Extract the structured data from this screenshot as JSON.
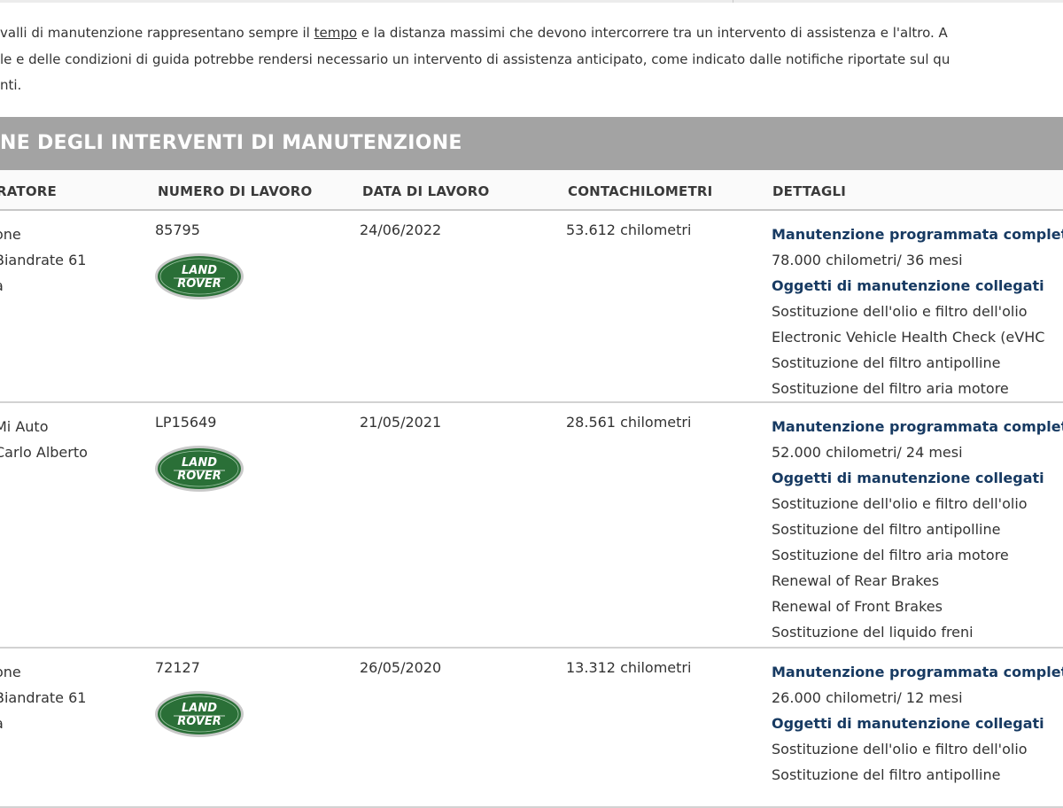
{
  "intro": {
    "line1_a": "valli di manutenzione rappresentano sempre il ",
    "line1_link": "tempo",
    "line1_b": " e la distanza massimi che devono intercorrere tra un intervento di assistenza e l'altro. A",
    "line2": "le e delle condizioni di guida potrebbe rendersi necessario un intervento di assistenza anticipato, come indicato dalle notifiche riportate sul qu",
    "line3": "nti."
  },
  "section": {
    "title": "NE DEGLI INTERVENTI DI MANUTENZIONE"
  },
  "columns": {
    "operator": "RATORE",
    "job_number": "NUMERO DI LAVORO",
    "job_date": "DATA DI LAVORO",
    "odometer": "CONTACHILOMETRI",
    "details": "DETTAGLI"
  },
  "logo": {
    "line1": "LAND",
    "line2": "ROVER",
    "color": "#2a6f37"
  },
  "records": [
    {
      "operator": [
        "one",
        "Biandrate 61",
        "a"
      ],
      "job_number": "85795",
      "date": "24/06/2022",
      "odometer": "53.612 chilometri",
      "details": [
        "Manutenzione programmata completa",
        "78.000 chilometri/ 36 mesi",
        "Oggetti di manutenzione collegati",
        "Sostituzione dell'olio e filtro dell'olio",
        "Electronic Vehicle Health Check (eVHC",
        "Sostituzione del filtro antipolline",
        "Sostituzione del filtro aria motore"
      ]
    },
    {
      "operator": [
        "Mi Auto",
        "Carlo Alberto"
      ],
      "job_number": "LP15649",
      "date": "21/05/2021",
      "odometer": "28.561 chilometri",
      "details": [
        "Manutenzione programmata completa",
        "52.000 chilometri/ 24 mesi",
        "Oggetti di manutenzione collegati",
        "Sostituzione dell'olio e filtro dell'olio",
        "Sostituzione del filtro antipolline",
        "Sostituzione del filtro aria motore",
        "Renewal of Rear Brakes",
        "Renewal of Front Brakes",
        "Sostituzione del liquido freni"
      ]
    },
    {
      "operator": [
        "one",
        "Biandrate 61",
        "a"
      ],
      "job_number": "72127",
      "date": "26/05/2020",
      "odometer": "13.312 chilometri",
      "details": [
        "Manutenzione programmata completa",
        "26.000 chilometri/ 12 mesi",
        "Oggetti di manutenzione collegati",
        "Sostituzione dell'olio e filtro dell'olio",
        "Sostituzione del filtro antipolline"
      ]
    }
  ]
}
